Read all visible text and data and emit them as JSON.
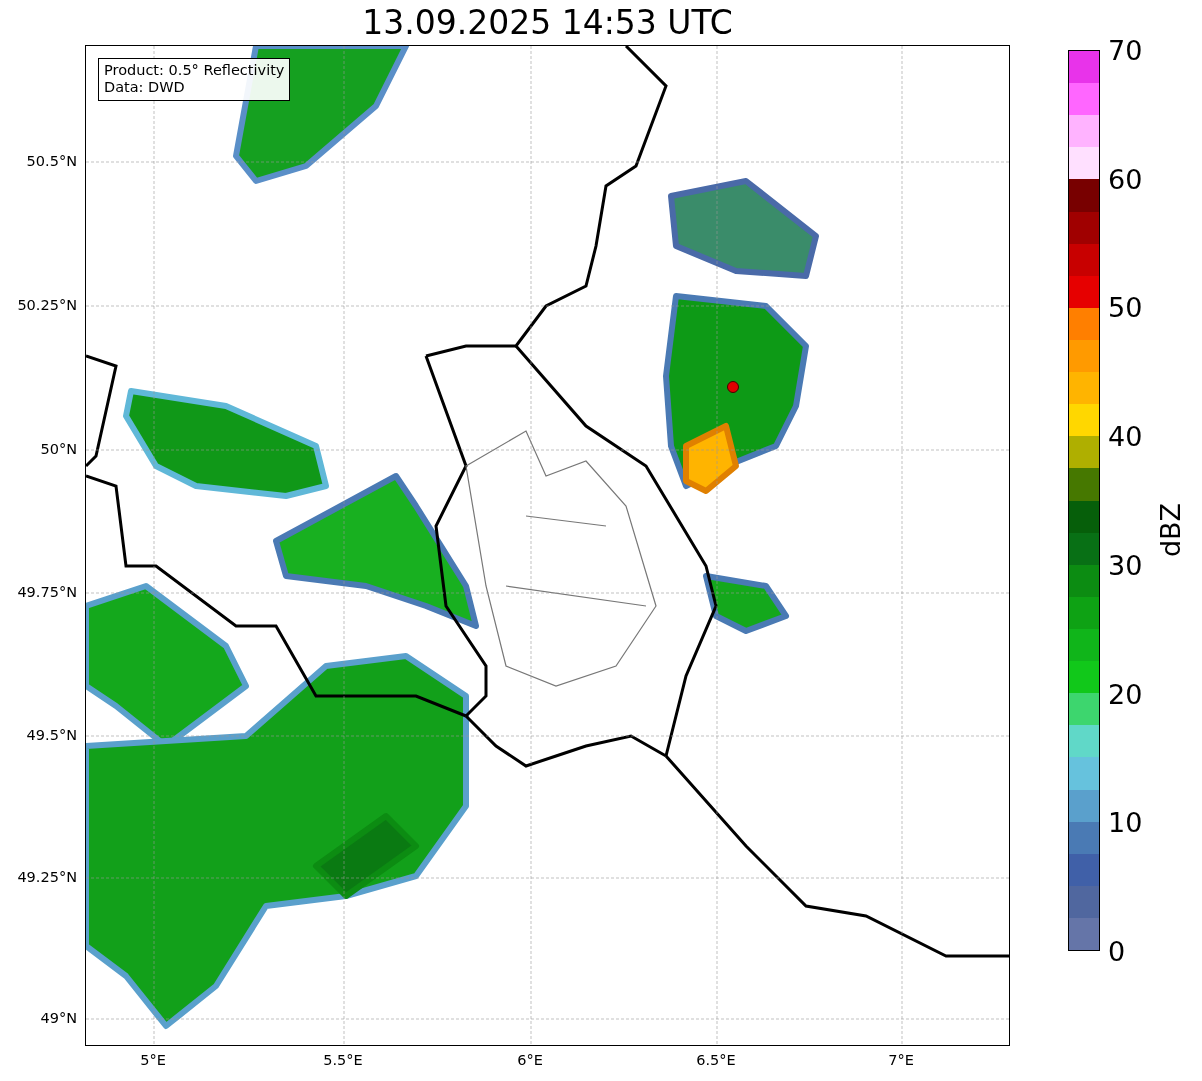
{
  "title": "13.09.2025 14:53 UTC",
  "info_box": {
    "lines": [
      "Product: 0.5° Reflectivity",
      "Data: DWD"
    ]
  },
  "map": {
    "x_ticks": [
      "5°E",
      "5.5°E",
      "6°E",
      "6.5°E",
      "7°E"
    ],
    "y_ticks": [
      "50.5°N",
      "50.25°N",
      "50°N",
      "49.75°N",
      "49.5°N",
      "49.25°N",
      "49°N"
    ]
  },
  "colorbar": {
    "label": "dBZ",
    "ticks": [
      "70",
      "60",
      "50",
      "40",
      "30",
      "20",
      "10",
      "0"
    ],
    "bins": [
      {
        "color": "#e833ea"
      },
      {
        "color": "#ff66ff"
      },
      {
        "color": "#ffb3ff"
      },
      {
        "color": "#ffe0ff"
      },
      {
        "color": "#780000"
      },
      {
        "color": "#a00000"
      },
      {
        "color": "#c80000"
      },
      {
        "color": "#e60000"
      },
      {
        "color": "#ff7f00"
      },
      {
        "color": "#ff9a00"
      },
      {
        "color": "#ffb400"
      },
      {
        "color": "#ffd700"
      },
      {
        "color": "#afaf00"
      },
      {
        "color": "#467800"
      },
      {
        "color": "#065f0a"
      },
      {
        "color": "#087015"
      },
      {
        "color": "#0c8c12"
      },
      {
        "color": "#0ea214"
      },
      {
        "color": "#10b51a"
      },
      {
        "color": "#11c81a"
      },
      {
        "color": "#3dd66e"
      },
      {
        "color": "#60d8c8"
      },
      {
        "color": "#66c2dd"
      },
      {
        "color": "#5aa0cc"
      },
      {
        "color": "#4a7ab4"
      },
      {
        "color": "#4060a8"
      },
      {
        "color": "#50679f"
      },
      {
        "color": "#6575a8"
      }
    ]
  }
}
